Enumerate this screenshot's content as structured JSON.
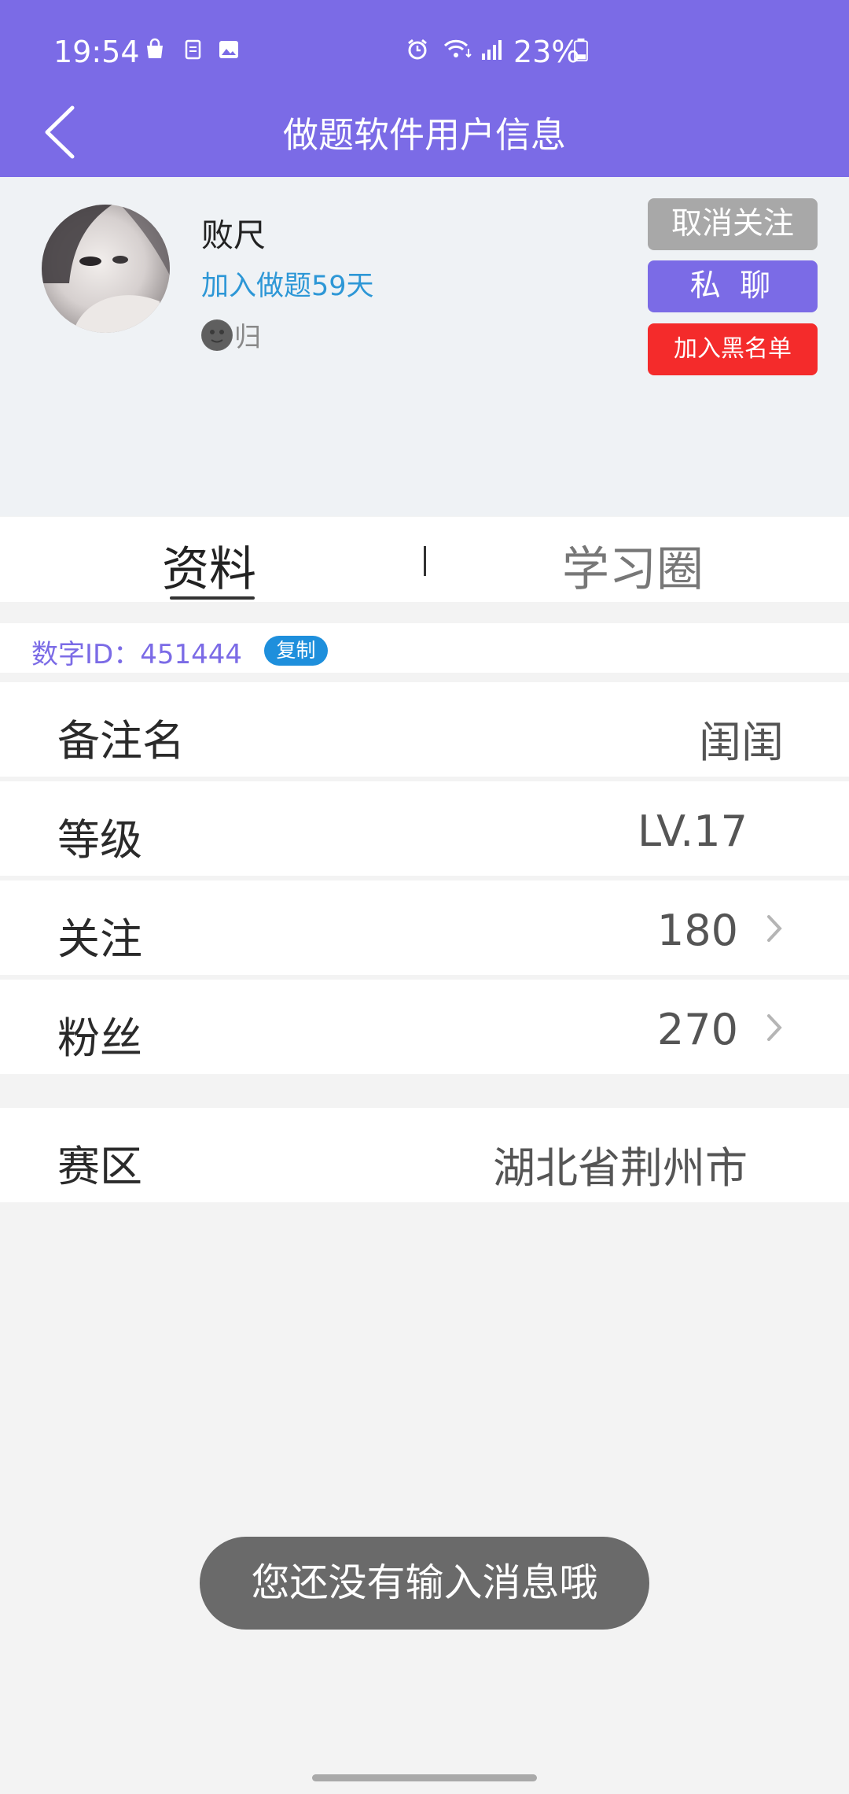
{
  "status_bar": {
    "time": "19:54",
    "battery": "23%"
  },
  "header": {
    "title": "做题软件用户信息"
  },
  "profile": {
    "name": "败尺",
    "joined": "加入做题59天",
    "signature": "归",
    "buttons": {
      "unfollow": "取消关注",
      "chat": "私 聊",
      "block": "加入黑名单"
    }
  },
  "tabs": [
    {
      "label": "资料"
    },
    {
      "label": "学习圈"
    }
  ],
  "digital_id": {
    "label": "数字ID：451444",
    "copy": "复制"
  },
  "details": [
    {
      "key": "备注名",
      "value": "闺闺"
    },
    {
      "key": "等级",
      "value": "LV.17"
    },
    {
      "key": "关注",
      "value": "180"
    },
    {
      "key": "粉丝",
      "value": "270"
    },
    {
      "key": "赛区",
      "value": "湖北省荆州市"
    }
  ],
  "toast": "您还没有输入消息哦",
  "colors": {
    "accent": "#7b6be6",
    "link": "#2d97d6",
    "danger": "#f42b2b"
  }
}
